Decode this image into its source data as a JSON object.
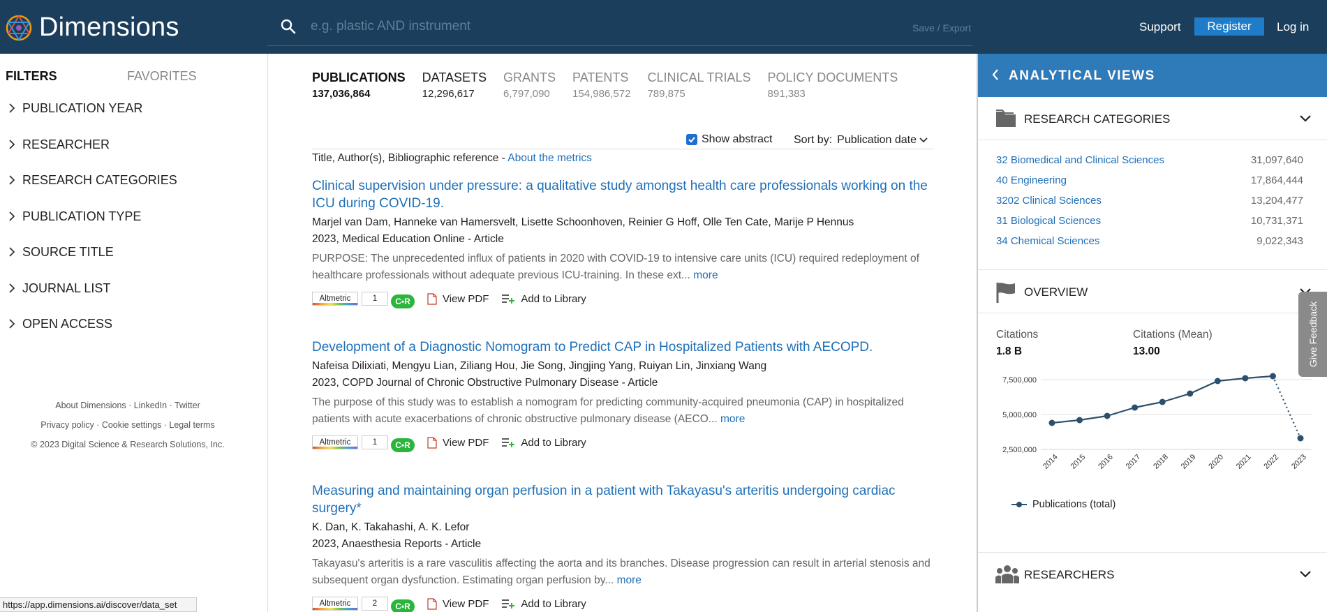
{
  "header": {
    "logo_text": "Dimensions",
    "search_placeholder": "e.g. plastic AND instrument",
    "save_export": "Save / Export",
    "support": "Support",
    "register": "Register",
    "login": "Log in"
  },
  "sidebar": {
    "tabs": {
      "filters": "FILTERS",
      "favorites": "FAVORITES"
    },
    "filters": [
      "PUBLICATION YEAR",
      "RESEARCHER",
      "RESEARCH CATEGORIES",
      "PUBLICATION TYPE",
      "SOURCE TITLE",
      "JOURNAL LIST",
      "OPEN ACCESS"
    ],
    "footer": {
      "about": "About Dimensions",
      "linkedin": "LinkedIn",
      "twitter": "Twitter",
      "privacy": "Privacy policy",
      "cookie": "Cookie settings",
      "legal": "Legal terms",
      "separator": " · ",
      "copyright": "© 2023 Digital Science & Research Solutions, Inc."
    }
  },
  "status_bar": "https://app.dimensions.ai/discover/data_set",
  "main": {
    "source_tabs": [
      {
        "label": "PUBLICATIONS",
        "count": "137,036,864"
      },
      {
        "label": "DATASETS",
        "count": "12,296,617"
      },
      {
        "label": "GRANTS",
        "count": "6,797,090"
      },
      {
        "label": "PATENTS",
        "count": "154,986,572"
      },
      {
        "label": "CLINICAL TRIALS",
        "count": "789,875"
      },
      {
        "label": "POLICY DOCUMENTS",
        "count": "891,383"
      }
    ],
    "show_abstract": "Show abstract",
    "sort_by_label": "Sort by:",
    "sort_by_value": "Publication date",
    "ref_line": "Title, Author(s), Bibliographic reference - ",
    "about_metrics": "About the metrics",
    "more_label": "more",
    "altmetric_label": "Altmetric",
    "crossref_label": "C•R",
    "view_pdf": "View PDF",
    "add_to_library": "Add to Library",
    "results": [
      {
        "title": "Clinical supervision under pressure: a qualitative study amongst health care professionals working on the ICU during COVID-19.",
        "authors": "Marjel van Dam, Hanneke van Hamersvelt, Lisette Schoonhoven, Reinier G Hoff, Olle Ten Cate, Marije P Hennus",
        "source": "2023, Medical Education Online - Article",
        "abstract": "PURPOSE: The unprecedented influx of patients in 2020 with COVID-19 to intensive care units (ICU) required redeployment of healthcare professionals without adequate previous ICU-training. In these ext...",
        "altmetric": "1"
      },
      {
        "title": "Development of a Diagnostic Nomogram to Predict CAP in Hospitalized Patients with AECOPD.",
        "authors": "Nafeisa Dilixiati, Mengyu Lian, Ziliang Hou, Jie Song, Jingjing Yang, Ruiyan Lin, Jinxiang Wang",
        "source": "2023, COPD Journal of Chronic Obstructive Pulmonary Disease - Article",
        "abstract": "The purpose of this study was to establish a nomogram for predicting community-acquired pneumonia (CAP) in hospitalized patients with acute exacerbations of chronic obstructive pulmonary disease (AECO...",
        "altmetric": "1"
      },
      {
        "title": "Measuring and maintaining organ perfusion in a patient with Takayasu's arteritis undergoing cardiac surgery*",
        "authors": "K. Dan, K. Takahashi, A. K. Lefor",
        "source": "2023, Anaesthesia Reports - Article",
        "abstract": "Takayasu's arteritis is a rare vasculitis affecting the aorta and its branches. Disease progression can result in arterial stenosis and subsequent organ dysfunction. Estimating organ perfusion by...",
        "altmetric": "2"
      }
    ]
  },
  "right_panel": {
    "title": "ANALYTICAL VIEWS",
    "research_categories": {
      "title": "RESEARCH CATEGORIES",
      "items": [
        {
          "name": "32 Biomedical and Clinical Sciences",
          "value": "31,097,640"
        },
        {
          "name": "40 Engineering",
          "value": "17,864,444"
        },
        {
          "name": "3202 Clinical Sciences",
          "value": "13,204,477"
        },
        {
          "name": "31 Biological Sciences",
          "value": "10,731,371"
        },
        {
          "name": "34 Chemical Sciences",
          "value": "9,022,343"
        }
      ]
    },
    "overview": {
      "title": "OVERVIEW",
      "citations_label": "Citations",
      "citations_value": "1.8 B",
      "citations_mean_label": "Citations (Mean)",
      "citations_mean_value": "13.00"
    },
    "researchers": {
      "title": "RESEARCHERS"
    },
    "feedback": "Give Feedback"
  },
  "chart_data": {
    "type": "line",
    "x": [
      "2014",
      "2015",
      "2016",
      "2017",
      "2018",
      "2019",
      "2020",
      "2021",
      "2022",
      "2023"
    ],
    "series": [
      {
        "name": "Publications (total)",
        "values": [
          4400000,
          4600000,
          4900000,
          5500000,
          5900000,
          6500000,
          7400000,
          7600000,
          7750000,
          3300000
        ]
      }
    ],
    "yticks": [
      "7,500,000",
      "5,000,000",
      "2,500,000"
    ],
    "ytick_values": [
      7500000,
      5000000,
      2500000
    ],
    "ylim": [
      2500000,
      7500000
    ],
    "last_segment_dotted": true,
    "colors": {
      "line": "#2c4f6b",
      "grid": "#e0e0e0",
      "baseline": "#c8d4e6"
    }
  }
}
